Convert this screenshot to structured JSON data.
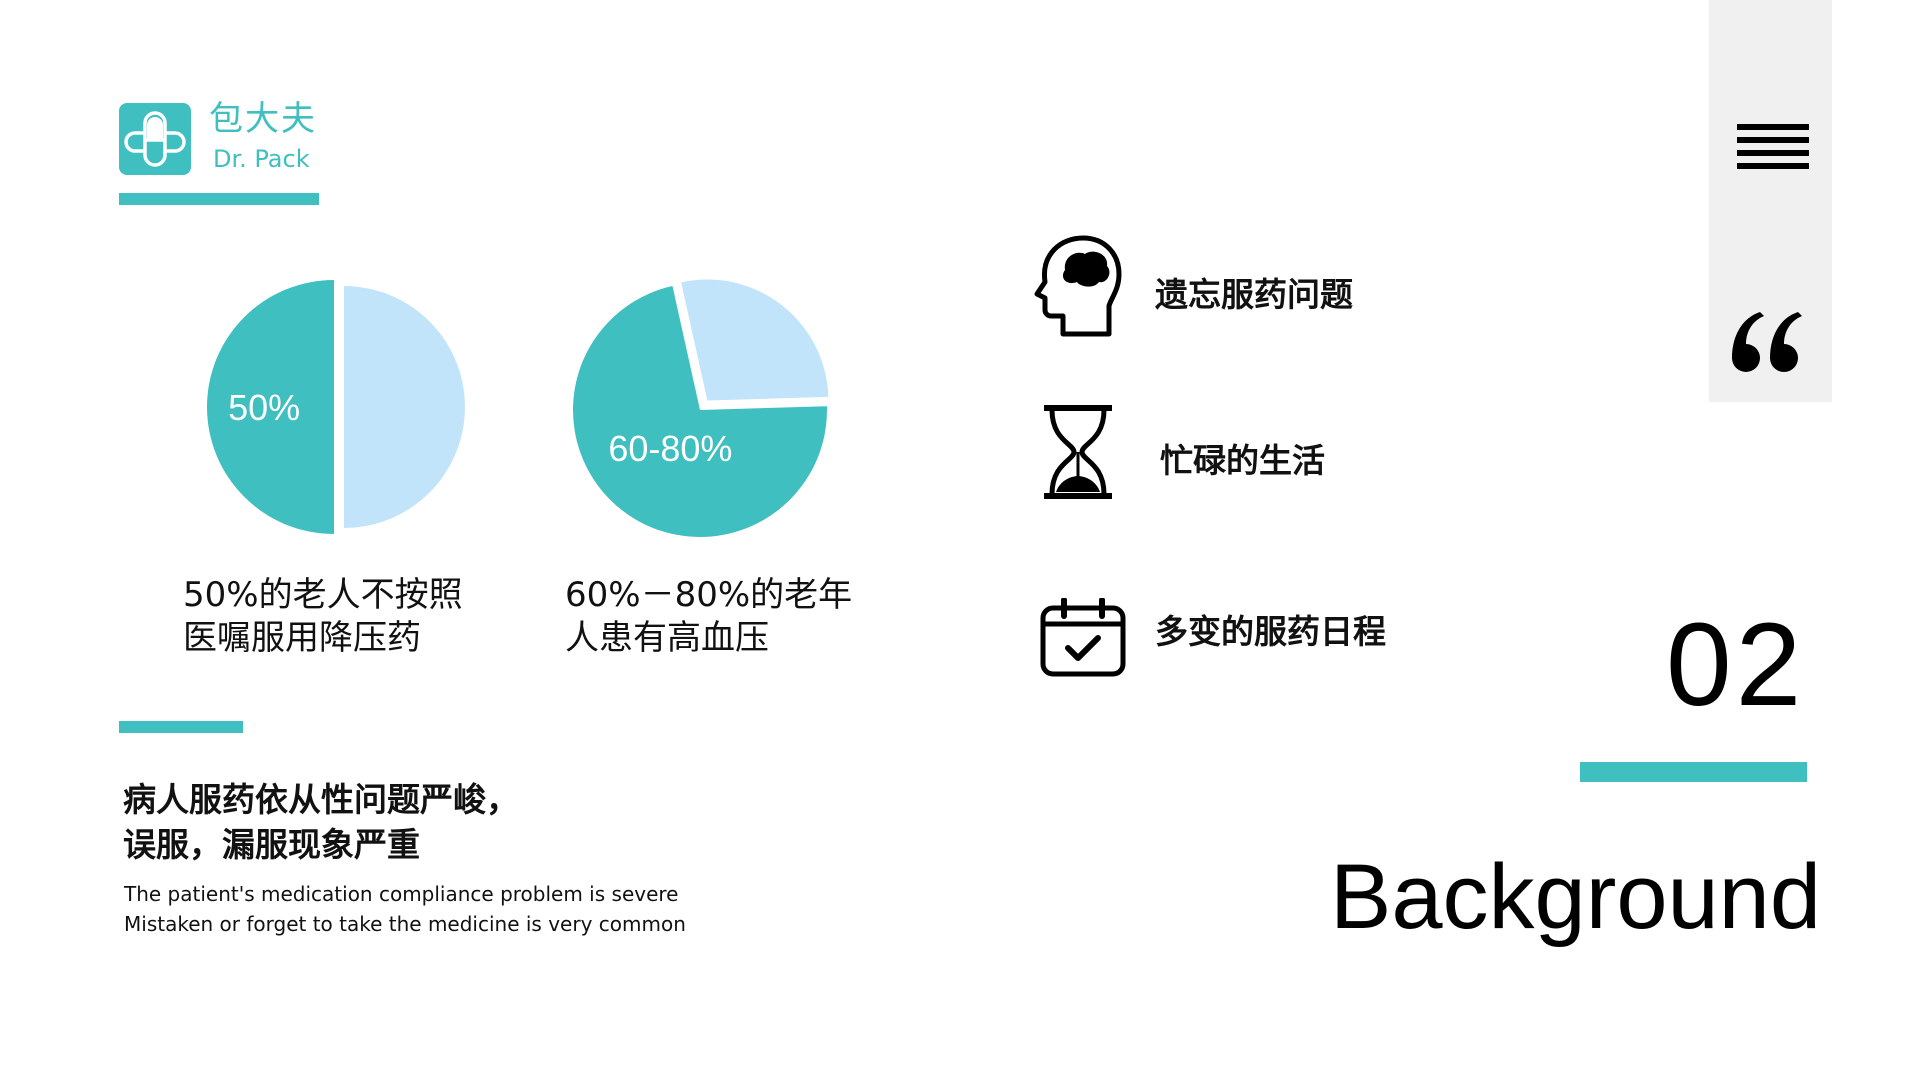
{
  "brand": {
    "name_cn": "包大夫",
    "name_en": "Dr. Pack",
    "accent": "#3fbfbf",
    "light": "#c2e4fb"
  },
  "chart_data": [
    {
      "type": "pie",
      "slices": [
        {
          "label": "50%",
          "value": 50,
          "color": "#3fbfbf"
        },
        {
          "label": "",
          "value": 50,
          "color": "#c2e4fb"
        }
      ],
      "caption": [
        "50%的老人不按照",
        "医嘱服用降压药"
      ]
    },
    {
      "type": "pie",
      "slices": [
        {
          "label": "60-80%",
          "value": 72,
          "color": "#3fbfbf"
        },
        {
          "label": "",
          "value": 28,
          "color": "#c2e4fb"
        }
      ],
      "caption": [
        "60%－80%的老年",
        "人患有高血压"
      ]
    }
  ],
  "summary": {
    "heading_cn": [
      "病人服药依从性问题严峻，",
      "误服，漏服现象严重"
    ],
    "text_en": [
      "The patient's medication compliance problem is severe",
      "Mistaken or forget to take the medicine is very common"
    ]
  },
  "issues": [
    {
      "icon": "brain-head-icon",
      "label": "遗忘服药问题"
    },
    {
      "icon": "hourglass-icon",
      "label": "忙碌的生活"
    },
    {
      "icon": "calendar-check-icon",
      "label": "多变的服药日程"
    }
  ],
  "section": {
    "number": "02",
    "title": "Background"
  }
}
